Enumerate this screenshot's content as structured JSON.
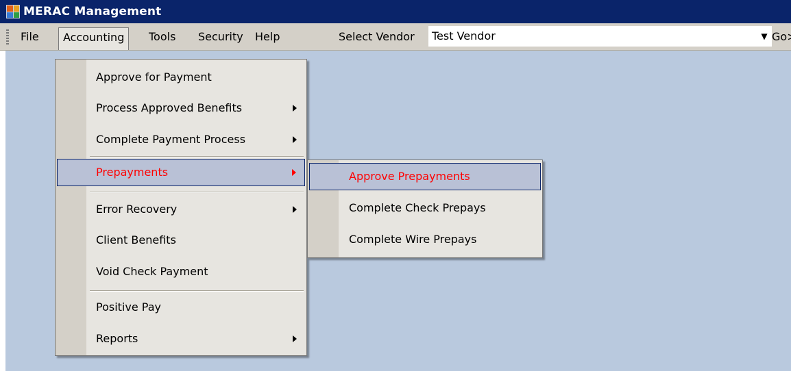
{
  "window": {
    "title": "MERAC Management"
  },
  "menubar": {
    "items": [
      {
        "label": "File"
      },
      {
        "label": "Accounting"
      },
      {
        "label": "Tools"
      },
      {
        "label": "Security"
      },
      {
        "label": "Help"
      }
    ],
    "vendor": {
      "label": "Select Vendor",
      "value": "Test Vendor"
    },
    "go_label": "Go>"
  },
  "accounting_menu": {
    "items": [
      {
        "label": "Approve for Payment",
        "submenu": false
      },
      {
        "label": "Process Approved Benefits",
        "submenu": true
      },
      {
        "label": "Complete Payment Process",
        "submenu": true
      },
      {
        "label": "Prepayments",
        "submenu": true,
        "highlighted": true
      },
      {
        "label": "Error Recovery",
        "submenu": true
      },
      {
        "label": "Client Benefits",
        "submenu": false
      },
      {
        "label": "Void Check Payment",
        "submenu": false
      },
      {
        "label": "Positive Pay",
        "submenu": false
      },
      {
        "label": "Reports",
        "submenu": true
      }
    ]
  },
  "prepayments_menu": {
    "items": [
      {
        "label": "Approve Prepayments",
        "highlighted": true
      },
      {
        "label": "Complete Check Prepays"
      },
      {
        "label": "Complete Wire Prepays"
      }
    ]
  },
  "colors": {
    "titlebar": "#0a246a",
    "workspace": "#b9c9de",
    "menu_bg": "#e7e5e0",
    "highlight_bg": "#b9c1d6",
    "highlight_text": "#ff0000"
  }
}
